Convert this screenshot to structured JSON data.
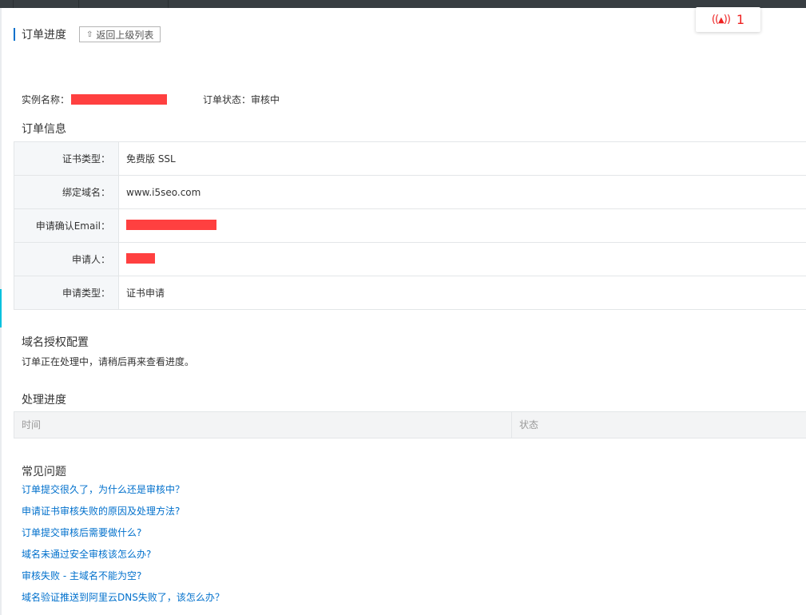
{
  "header": {
    "title": "订单进度",
    "back_label": "返回上级列表",
    "back_icon": "upload-arrow-icon"
  },
  "notification": {
    "icon": "bell-icon",
    "bell_glyph": "((🔔))",
    "count": "1",
    "color": "#ee2222"
  },
  "instance": {
    "name_label": "实例名称：",
    "status_label": "订单状态：审核中"
  },
  "order_info": {
    "section_title": "订单信息",
    "rows": [
      {
        "key": "证书类型：",
        "value": "免费版 SSL"
      },
      {
        "key": "绑定域名：",
        "value": "www.i5seo.com"
      },
      {
        "key": "申请确认Email：",
        "value": ""
      },
      {
        "key": "申请人：",
        "value": ""
      },
      {
        "key": "申请类型：",
        "value": "证书申请"
      }
    ]
  },
  "domain_auth": {
    "section_title": "域名授权配置",
    "message": "订单正在处理中，请稍后再来查看进度。"
  },
  "progress": {
    "section_title": "处理进度",
    "col_time": "时间",
    "col_status": "状态"
  },
  "faq": {
    "section_title": "常见问题",
    "items": [
      "订单提交很久了，为什么还是审核中？",
      "申请证书审核失败的原因及处理方法?",
      "订单提交审核后需要做什么?",
      "域名未通过安全审核该怎么办?",
      "审核失败 - 主域名不能为空?",
      "域名验证推送到阿里云DNS失败了，该怎么办？"
    ]
  },
  "colors": {
    "link": "#0070cc",
    "redaction": "#ff4040",
    "accent": "#00c1de"
  }
}
